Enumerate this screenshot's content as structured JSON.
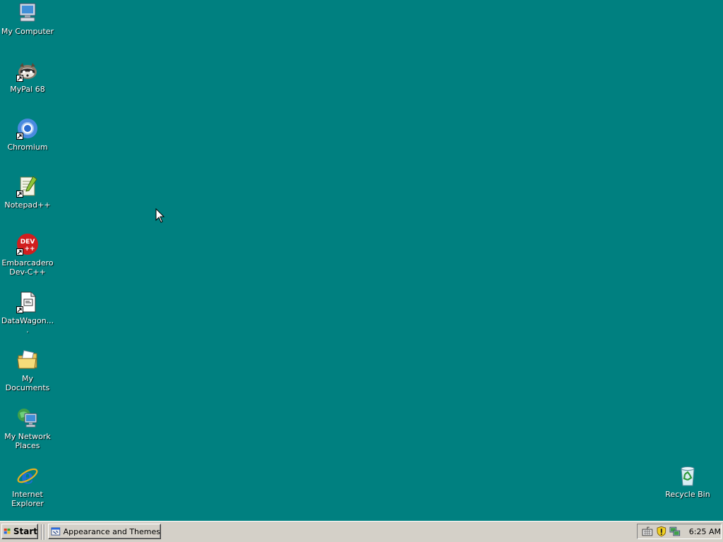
{
  "desktop": {
    "background_color": "#008080",
    "icons": [
      {
        "label": "My Computer",
        "icon": "my-computer-icon"
      },
      {
        "label": "MyPal 68",
        "icon": "mypal-icon"
      },
      {
        "label": "Chromium",
        "icon": "chromium-icon"
      },
      {
        "label": "Notepad++",
        "icon": "notepad-plus-plus-icon"
      },
      {
        "label": "Embarcadero Dev-C++",
        "icon": "devcpp-icon",
        "badge": "DEV"
      },
      {
        "label": "DataWagon....",
        "icon": "datawagon-icon"
      },
      {
        "label": "My Documents",
        "icon": "my-documents-icon"
      },
      {
        "label": "My Network Places",
        "icon": "network-places-icon"
      },
      {
        "label": "Internet Explorer",
        "icon": "internet-explorer-icon"
      },
      {
        "label": "Recycle Bin",
        "icon": "recycle-bin-icon"
      }
    ]
  },
  "taskbar": {
    "start_label": "Start",
    "tasks": [
      {
        "label": "Appearance and Themes",
        "icon": "control-panel-icon"
      }
    ],
    "tray": {
      "icons": [
        "keyboard-icon",
        "security-shield-icon",
        "network-icon"
      ],
      "clock": "6:25 AM"
    }
  }
}
